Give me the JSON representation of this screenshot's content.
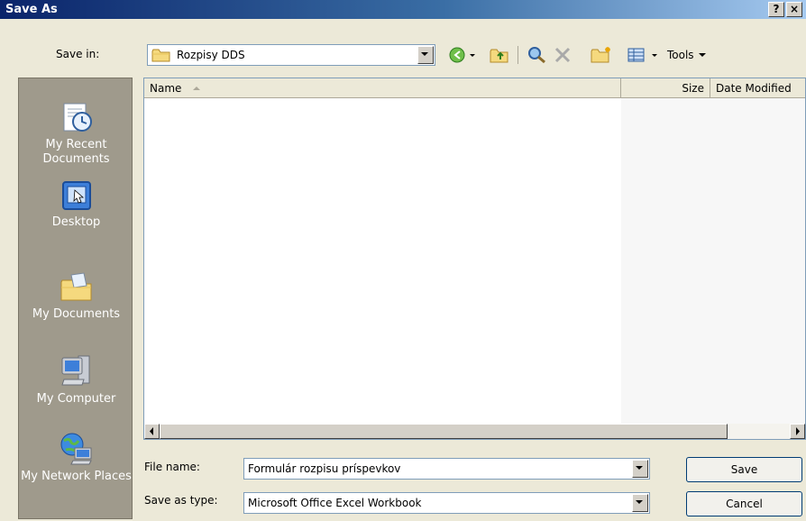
{
  "window": {
    "title": "Save As",
    "help_label": "?",
    "close_label": "×"
  },
  "save_in": {
    "label": "Save in:",
    "value": "Rozpisy DDS"
  },
  "toolbar": {
    "back_icon": "back-arrow-icon",
    "up_icon": "up-folder-icon",
    "search_icon": "search-web-icon",
    "delete_icon": "delete-icon",
    "new_folder_icon": "new-folder-icon",
    "views_icon": "views-icon",
    "tools_label": "Tools"
  },
  "places": [
    {
      "label": "My Recent Documents",
      "icon": "recent-documents-icon"
    },
    {
      "label": "Desktop",
      "icon": "desktop-icon"
    },
    {
      "label": "My Documents",
      "icon": "my-documents-icon"
    },
    {
      "label": "My Computer",
      "icon": "my-computer-icon"
    },
    {
      "label": "My Network Places",
      "icon": "network-places-icon"
    }
  ],
  "file_list": {
    "columns": [
      "Name",
      "Size",
      "Date Modified"
    ],
    "sort_column": "Name",
    "rows": []
  },
  "file_name": {
    "label": "File name:",
    "value": "Formulár rozpisu príspevkov"
  },
  "save_as_type": {
    "label": "Save as type:",
    "value": "Microsoft Office Excel Workbook"
  },
  "buttons": {
    "save_label": "Save",
    "cancel_label": "Cancel"
  },
  "colors": {
    "title_bar_start": "#0a246a",
    "title_bar_end": "#a6caf0",
    "places_bar": "#9f9a8c",
    "dialog_bg": "#ece9d8"
  }
}
